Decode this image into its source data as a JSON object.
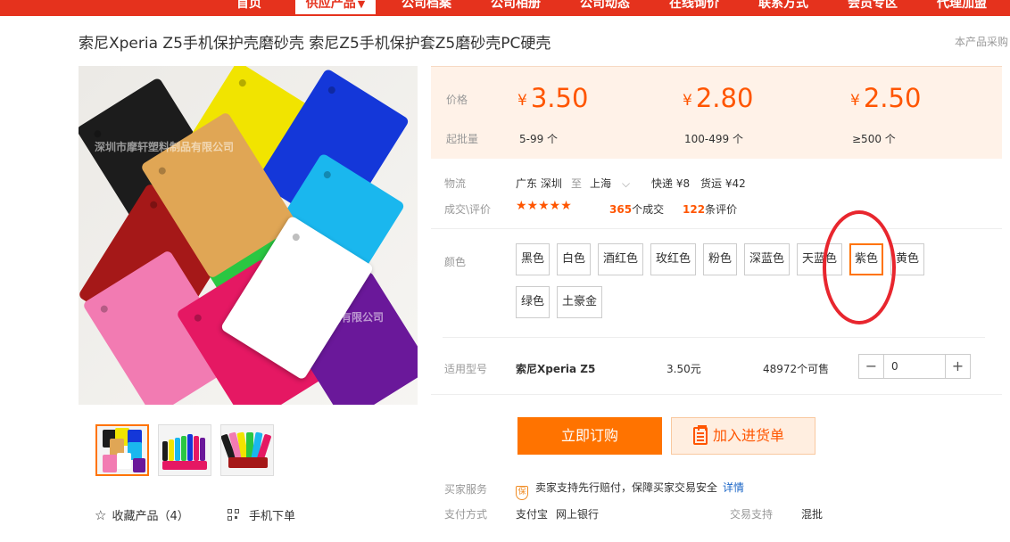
{
  "nav": {
    "items": [
      {
        "label": "首页"
      },
      {
        "label": "供应产品"
      },
      {
        "label": "公司档案"
      },
      {
        "label": "公司相册"
      },
      {
        "label": "公司动态"
      },
      {
        "label": "在线询价"
      },
      {
        "label": "联系方式"
      },
      {
        "label": "会员专区"
      },
      {
        "label": "代理加盟"
      }
    ],
    "caret": "▼"
  },
  "product": {
    "title": "索尼Xperia Z5手机保护壳磨砂壳 索尼Z5手机保护套Z5磨砂壳PC硬壳",
    "purchase_link": "本产品采购",
    "watermark": "深圳市摩轩塑料制品有限公司"
  },
  "prices": {
    "price_label": "价格",
    "moq_label": "起批量",
    "currency": "¥",
    "tiers": [
      {
        "price": "3.50",
        "qty": "5-99 个"
      },
      {
        "price": "2.80",
        "qty": "100-499 个"
      },
      {
        "price": "2.50",
        "qty": "≥500 个"
      }
    ]
  },
  "logistics": {
    "label": "物流",
    "from": "广东 深圳",
    "to_word": "至",
    "to": "上海",
    "express": "快递 ¥8",
    "freight": "货运 ¥42"
  },
  "reviews": {
    "label": "成交\\评价",
    "stars": "★★★★★",
    "deals_count": "365",
    "deals_text": "个成交",
    "review_count": "122",
    "review_text": "条评价"
  },
  "colors": {
    "label": "颜色",
    "options": [
      "黑色",
      "白色",
      "酒红色",
      "玫红色",
      "粉色",
      "深蓝色",
      "天蓝色",
      "紫色",
      "黄色",
      "绿色",
      "土豪金"
    ],
    "selected": "紫色"
  },
  "model": {
    "label": "适用型号",
    "name": "索尼Xperia Z5",
    "price": "3.50元",
    "stock": "48972个可售",
    "quantity": "0",
    "minus": "−",
    "plus": "+"
  },
  "actions": {
    "order": "立即订购",
    "cart": "加入进货单"
  },
  "service": {
    "label": "买家服务",
    "icon_text": "保",
    "text": "卖家支持先行赔付，保障买家交易安全",
    "detail": "详情"
  },
  "payment": {
    "label": "支付方式",
    "methods": [
      "支付宝",
      "网上银行"
    ],
    "trade_label": "交易支持",
    "trade_value": "混批"
  },
  "gallery": {
    "favorite": "收藏产品（4）",
    "mobile_order": "手机下单"
  },
  "colors_hex": {
    "brand_red": "#e5321d",
    "accent_orange": "#ff7300",
    "price_orange": "#ff5500",
    "circle_red": "#e8262e"
  }
}
